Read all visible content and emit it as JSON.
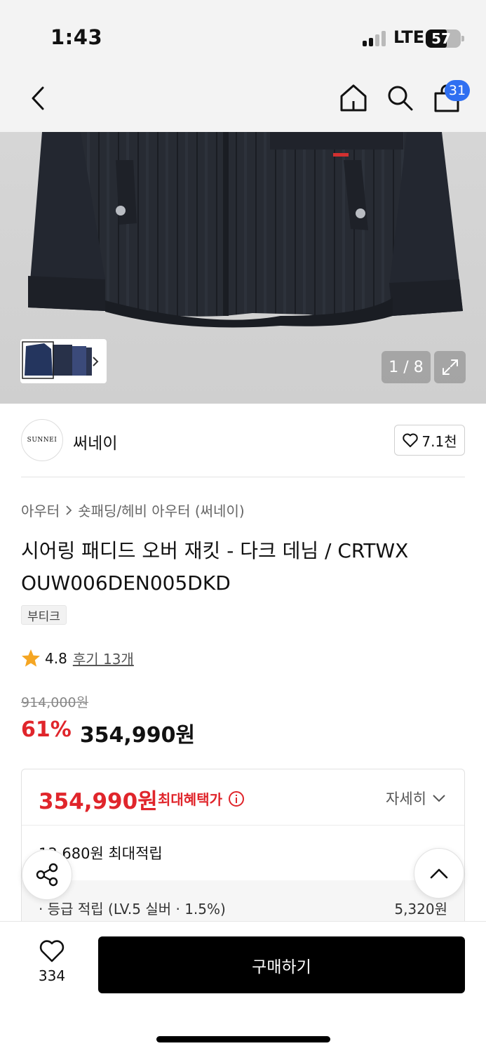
{
  "status": {
    "time": "1:43",
    "network": "LTE",
    "battery": "57"
  },
  "nav": {
    "cart_count": "31"
  },
  "gallery": {
    "counter": "1 / 8"
  },
  "brand": {
    "logo_text": "SUNNEI",
    "name": "써네이",
    "likes": "7.1천"
  },
  "breadcrumb": {
    "items": [
      "아우터",
      "숏패딩/헤비 아우터 (써네이)"
    ]
  },
  "product": {
    "title": "시어링 패디드 오버 재킷 - 다크 데님 / CRTWX OUW006DEN005DKD",
    "tag": "부티크",
    "rating": "4.8",
    "review_link": "후기 13개",
    "original_price": "914,000원",
    "discount": "61%",
    "price": "354,990원"
  },
  "benefit": {
    "price": "354,990원",
    "label": "최대혜택가",
    "detail_label": "자세히",
    "points": "13,680원 최대적립",
    "grade_label": "· 등급 적립 (LV.5 실버 · 1.5%)",
    "grade_value": "5,320원"
  },
  "bottom": {
    "wish_count": "334",
    "buy_label": "구매하기"
  },
  "colors": {
    "accent_red": "#e0252b",
    "badge_blue": "#2f6ff1"
  }
}
